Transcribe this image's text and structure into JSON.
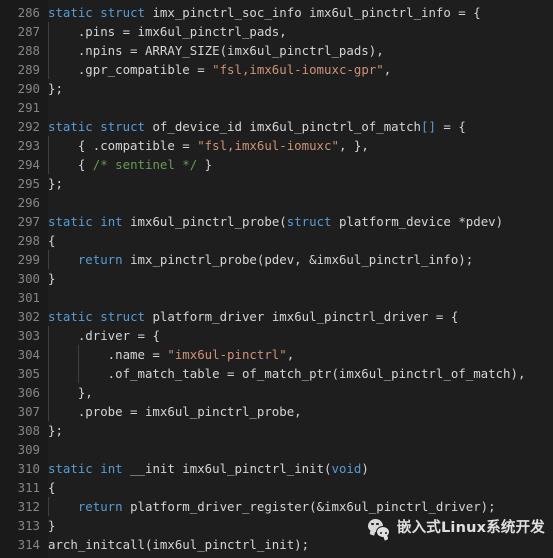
{
  "editor": {
    "theme_name": "dark-plus",
    "background": "#1e1e1e",
    "gutter_background": "#1a1a1a",
    "line_number_color": "#858585",
    "default_text_color": "#d4d4d4",
    "keyword_color": "#569cd6",
    "string_color": "#ce9178",
    "comment_color": "#6a9955",
    "bracket_color": "#569cd6",
    "indent_guide_color": "#404040",
    "first_line_number": 286,
    "last_line_number": 314
  },
  "code": {
    "language": "c",
    "lines": [
      {
        "num": "286",
        "indent": 0,
        "tokens": [
          {
            "t": "static",
            "c": "key"
          },
          {
            "t": " ",
            "c": "plain"
          },
          {
            "t": "struct",
            "c": "key"
          },
          {
            "t": " imx_pinctrl_soc_info imx6ul_pinctrl_info = ",
            "c": "plain"
          },
          {
            "t": "{",
            "c": "br1"
          }
        ]
      },
      {
        "num": "287",
        "indent": 1,
        "tokens": [
          {
            "t": "    .pins = imx6ul_pinctrl_pads,",
            "c": "plain"
          }
        ]
      },
      {
        "num": "288",
        "indent": 1,
        "tokens": [
          {
            "t": "    .npins = ARRAY_SIZE(imx6ul_pinctrl_pads),",
            "c": "plain"
          }
        ]
      },
      {
        "num": "289",
        "indent": 1,
        "tokens": [
          {
            "t": "    .gpr_compatible = ",
            "c": "plain"
          },
          {
            "t": "\"fsl,imx6ul-iomuxc-gpr\"",
            "c": "str"
          },
          {
            "t": ",",
            "c": "plain"
          }
        ]
      },
      {
        "num": "290",
        "indent": 0,
        "tokens": [
          {
            "t": "};",
            "c": "plain"
          }
        ]
      },
      {
        "num": "291",
        "indent": 0,
        "tokens": []
      },
      {
        "num": "292",
        "indent": 0,
        "tokens": [
          {
            "t": "static",
            "c": "key"
          },
          {
            "t": " ",
            "c": "plain"
          },
          {
            "t": "struct",
            "c": "key"
          },
          {
            "t": " of_device_id imx6ul_pinctrl_of_match",
            "c": "plain"
          },
          {
            "t": "[]",
            "c": "br2"
          },
          {
            "t": " = ",
            "c": "plain"
          },
          {
            "t": "{",
            "c": "br1"
          }
        ]
      },
      {
        "num": "293",
        "indent": 1,
        "tokens": [
          {
            "t": "    { .compatible = ",
            "c": "plain"
          },
          {
            "t": "\"fsl,imx6ul-iomuxc\"",
            "c": "str"
          },
          {
            "t": ", },",
            "c": "plain"
          }
        ]
      },
      {
        "num": "294",
        "indent": 1,
        "tokens": [
          {
            "t": "    { ",
            "c": "plain"
          },
          {
            "t": "/* sentinel */",
            "c": "com"
          },
          {
            "t": " }",
            "c": "plain"
          }
        ]
      },
      {
        "num": "295",
        "indent": 0,
        "tokens": [
          {
            "t": "};",
            "c": "plain"
          }
        ]
      },
      {
        "num": "296",
        "indent": 0,
        "tokens": []
      },
      {
        "num": "297",
        "indent": 0,
        "tokens": [
          {
            "t": "static",
            "c": "key"
          },
          {
            "t": " ",
            "c": "plain"
          },
          {
            "t": "int",
            "c": "key"
          },
          {
            "t": " imx6ul_pinctrl_probe(",
            "c": "plain"
          },
          {
            "t": "struct",
            "c": "key"
          },
          {
            "t": " platform_device *pdev)",
            "c": "plain"
          }
        ]
      },
      {
        "num": "298",
        "indent": 0,
        "tokens": [
          {
            "t": "{",
            "c": "plain"
          }
        ]
      },
      {
        "num": "299",
        "indent": 1,
        "tokens": [
          {
            "t": "    ",
            "c": "plain"
          },
          {
            "t": "return",
            "c": "key"
          },
          {
            "t": " imx_pinctrl_probe(pdev, &imx6ul_pinctrl_info);",
            "c": "plain"
          }
        ]
      },
      {
        "num": "300",
        "indent": 0,
        "tokens": [
          {
            "t": "}",
            "c": "plain"
          }
        ]
      },
      {
        "num": "301",
        "indent": 0,
        "tokens": []
      },
      {
        "num": "302",
        "indent": 0,
        "tokens": [
          {
            "t": "static",
            "c": "key"
          },
          {
            "t": " ",
            "c": "plain"
          },
          {
            "t": "struct",
            "c": "key"
          },
          {
            "t": " platform_driver imx6ul_pinctrl_driver = ",
            "c": "plain"
          },
          {
            "t": "{",
            "c": "br1"
          }
        ]
      },
      {
        "num": "303",
        "indent": 1,
        "tokens": [
          {
            "t": "    .driver = ",
            "c": "plain"
          },
          {
            "t": "{",
            "c": "br1"
          }
        ]
      },
      {
        "num": "304",
        "indent": 2,
        "tokens": [
          {
            "t": "        .name = ",
            "c": "plain"
          },
          {
            "t": "\"imx6ul-pinctrl\"",
            "c": "str"
          },
          {
            "t": ",",
            "c": "plain"
          }
        ]
      },
      {
        "num": "305",
        "indent": 2,
        "tokens": [
          {
            "t": "        .of_match_table = of_match_ptr(imx6ul_pinctrl_of_match),",
            "c": "plain"
          }
        ]
      },
      {
        "num": "306",
        "indent": 1,
        "tokens": [
          {
            "t": "    },",
            "c": "plain"
          }
        ]
      },
      {
        "num": "307",
        "indent": 1,
        "tokens": [
          {
            "t": "    .probe = imx6ul_pinctrl_probe,",
            "c": "plain"
          }
        ]
      },
      {
        "num": "308",
        "indent": 0,
        "tokens": [
          {
            "t": "};",
            "c": "plain"
          }
        ]
      },
      {
        "num": "309",
        "indent": 0,
        "tokens": []
      },
      {
        "num": "310",
        "indent": 0,
        "tokens": [
          {
            "t": "static",
            "c": "key"
          },
          {
            "t": " ",
            "c": "plain"
          },
          {
            "t": "int",
            "c": "key"
          },
          {
            "t": " __init imx6ul_pinctrl_init(",
            "c": "plain"
          },
          {
            "t": "void",
            "c": "key"
          },
          {
            "t": ")",
            "c": "plain"
          }
        ]
      },
      {
        "num": "311",
        "indent": 0,
        "tokens": [
          {
            "t": "{",
            "c": "plain"
          }
        ]
      },
      {
        "num": "312",
        "indent": 1,
        "tokens": [
          {
            "t": "    ",
            "c": "plain"
          },
          {
            "t": "return",
            "c": "key"
          },
          {
            "t": " platform_driver_register(&imx6ul_pinctrl_driver);",
            "c": "plain"
          }
        ]
      },
      {
        "num": "313",
        "indent": 0,
        "tokens": [
          {
            "t": "}",
            "c": "plain"
          }
        ]
      },
      {
        "num": "314",
        "indent": 0,
        "tokens": [
          {
            "t": "arch_initcall(imx6ul_pinctrl_init);",
            "c": "plain"
          }
        ]
      }
    ]
  },
  "watermark": {
    "icon": "wechat-logo-icon",
    "text": "嵌入式Linux系统开发"
  }
}
